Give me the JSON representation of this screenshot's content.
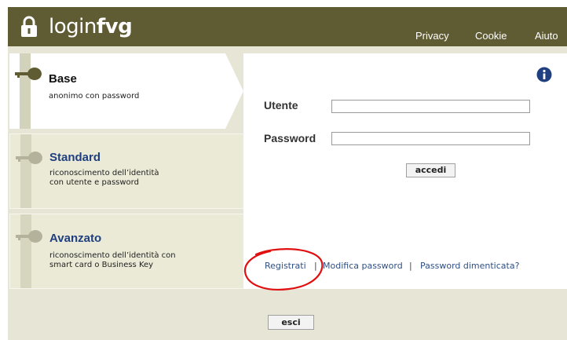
{
  "header": {
    "logo_light": "login",
    "logo_bold": "fvg",
    "nav": [
      {
        "label": "Privacy"
      },
      {
        "label": "Cookie"
      },
      {
        "label": "Aiuto"
      }
    ]
  },
  "levels": [
    {
      "title": "Base",
      "subtitle_lines": [
        "anonimo con password"
      ],
      "selected": true
    },
    {
      "title": "Standard",
      "subtitle_lines": [
        "riconoscimento dell’identità",
        "con utente e password"
      ],
      "selected": false
    },
    {
      "title": "Avanzato",
      "subtitle_lines": [
        "riconoscimento dell’identità con",
        "smart card o Business Key"
      ],
      "selected": false
    }
  ],
  "form": {
    "user_label": "Utente",
    "user_value": "",
    "password_label": "Password",
    "password_value": "",
    "submit_label": "accedi"
  },
  "links": {
    "register": "Registrati",
    "separator": "|",
    "change_password": "Modifica password",
    "forgot_password": "Password dimenticata?"
  },
  "footer": {
    "exit_label": "esci"
  },
  "colors": {
    "header_bg": "#5f5b33",
    "panel_bg": "#e6e5d6",
    "title_blue": "#1f3f80",
    "annotation_red": "#e01010"
  },
  "icons": [
    "lock-icon",
    "key-icon",
    "info-icon"
  ]
}
